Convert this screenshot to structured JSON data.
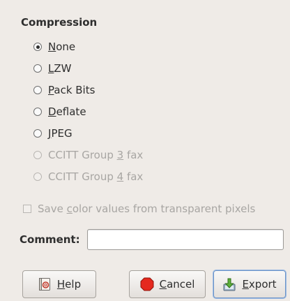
{
  "compression": {
    "heading": "Compression",
    "options": [
      {
        "pre": "",
        "mn": "N",
        "post": "one",
        "checked": true,
        "disabled": false
      },
      {
        "pre": "",
        "mn": "L",
        "post": "ZW",
        "checked": false,
        "disabled": false
      },
      {
        "pre": "",
        "mn": "P",
        "post": "ack Bits",
        "checked": false,
        "disabled": false
      },
      {
        "pre": "",
        "mn": "D",
        "post": "eflate",
        "checked": false,
        "disabled": false
      },
      {
        "pre": "",
        "mn": "J",
        "post": "PEG",
        "checked": false,
        "disabled": false
      },
      {
        "pre": "CCITT Group ",
        "mn": "3",
        "post": " fax",
        "checked": false,
        "disabled": true
      },
      {
        "pre": "CCITT Group ",
        "mn": "4",
        "post": " fax",
        "checked": false,
        "disabled": true
      }
    ]
  },
  "save_color": {
    "pre": "Save ",
    "mn": "c",
    "post": "olor values from transparent pixels",
    "checked": false,
    "disabled": true
  },
  "comment": {
    "label": "Comment:",
    "value": ""
  },
  "buttons": {
    "help": {
      "mn": "H",
      "post": "elp"
    },
    "cancel": {
      "mn": "C",
      "post": "ancel"
    },
    "export": {
      "mn": "E",
      "post": "xport"
    }
  },
  "icons": {
    "help": "help-book-icon",
    "cancel": "cancel-stop-icon",
    "export": "export-icon"
  }
}
